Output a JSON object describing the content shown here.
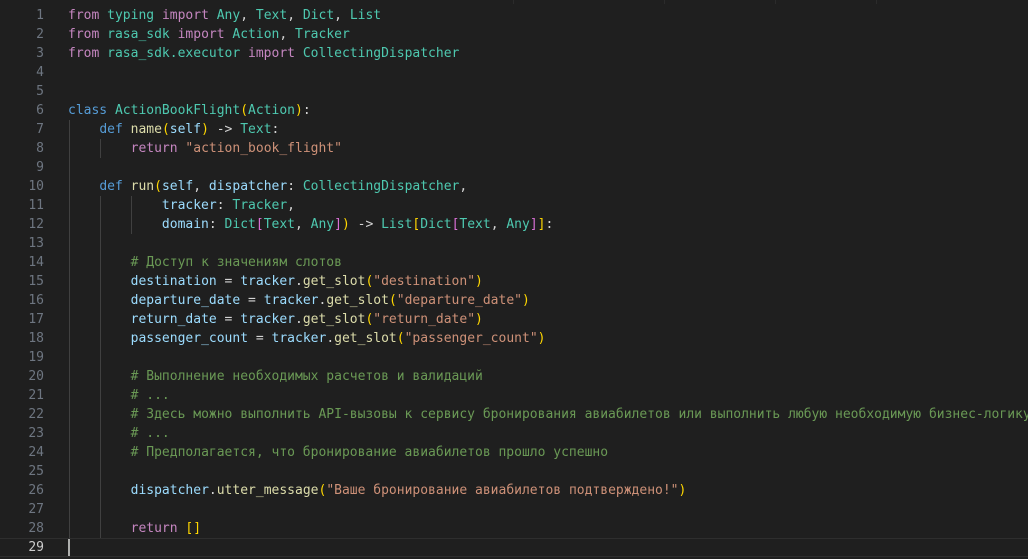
{
  "editor": {
    "active_line": 29,
    "lines": [
      {
        "n": "1",
        "tokens": [
          [
            "kw",
            "from"
          ],
          [
            "op",
            " "
          ],
          [
            "cls",
            "typing"
          ],
          [
            "op",
            " "
          ],
          [
            "kw",
            "import"
          ],
          [
            "op",
            " "
          ],
          [
            "cls",
            "Any"
          ],
          [
            "op",
            ", "
          ],
          [
            "cls",
            "Text"
          ],
          [
            "op",
            ", "
          ],
          [
            "cls",
            "Dict"
          ],
          [
            "op",
            ", "
          ],
          [
            "cls",
            "List"
          ]
        ]
      },
      {
        "n": "2",
        "tokens": [
          [
            "kw",
            "from"
          ],
          [
            "op",
            " "
          ],
          [
            "cls",
            "rasa_sdk"
          ],
          [
            "op",
            " "
          ],
          [
            "kw",
            "import"
          ],
          [
            "op",
            " "
          ],
          [
            "cls",
            "Action"
          ],
          [
            "op",
            ", "
          ],
          [
            "cls",
            "Tracker"
          ]
        ]
      },
      {
        "n": "3",
        "tokens": [
          [
            "kw",
            "from"
          ],
          [
            "op",
            " "
          ],
          [
            "cls",
            "rasa_sdk.executor"
          ],
          [
            "op",
            " "
          ],
          [
            "kw",
            "import"
          ],
          [
            "op",
            " "
          ],
          [
            "cls",
            "CollectingDispatcher"
          ]
        ]
      },
      {
        "n": "4",
        "tokens": []
      },
      {
        "n": "5",
        "tokens": []
      },
      {
        "n": "6",
        "tokens": [
          [
            "def",
            "class"
          ],
          [
            "op",
            " "
          ],
          [
            "cls",
            "ActionBookFlight"
          ],
          [
            "p1",
            "("
          ],
          [
            "cls",
            "Action"
          ],
          [
            "p1",
            ")"
          ],
          [
            "op",
            ":"
          ]
        ]
      },
      {
        "n": "7",
        "tokens": [
          [
            "op",
            "    "
          ],
          [
            "def",
            "def"
          ],
          [
            "op",
            " "
          ],
          [
            "fn",
            "name"
          ],
          [
            "p1",
            "("
          ],
          [
            "var",
            "self"
          ],
          [
            "p1",
            ")"
          ],
          [
            "op",
            " -> "
          ],
          [
            "cls",
            "Text"
          ],
          [
            "op",
            ":"
          ]
        ]
      },
      {
        "n": "8",
        "tokens": [
          [
            "op",
            "        "
          ],
          [
            "kw",
            "return"
          ],
          [
            "op",
            " "
          ],
          [
            "str",
            "\"action_book_flight\""
          ]
        ]
      },
      {
        "n": "9",
        "tokens": []
      },
      {
        "n": "10",
        "tokens": [
          [
            "op",
            "    "
          ],
          [
            "def",
            "def"
          ],
          [
            "op",
            " "
          ],
          [
            "fn",
            "run"
          ],
          [
            "p1",
            "("
          ],
          [
            "var",
            "self"
          ],
          [
            "op",
            ", "
          ],
          [
            "var",
            "dispatcher"
          ],
          [
            "op",
            ": "
          ],
          [
            "cls",
            "CollectingDispatcher"
          ],
          [
            "op",
            ","
          ]
        ]
      },
      {
        "n": "11",
        "tokens": [
          [
            "op",
            "            "
          ],
          [
            "var",
            "tracker"
          ],
          [
            "op",
            ": "
          ],
          [
            "cls",
            "Tracker"
          ],
          [
            "op",
            ","
          ]
        ]
      },
      {
        "n": "12",
        "tokens": [
          [
            "op",
            "            "
          ],
          [
            "var",
            "domain"
          ],
          [
            "op",
            ": "
          ],
          [
            "cls",
            "Dict"
          ],
          [
            "p2",
            "["
          ],
          [
            "cls",
            "Text"
          ],
          [
            "op",
            ", "
          ],
          [
            "cls",
            "Any"
          ],
          [
            "p2",
            "]"
          ],
          [
            "p1",
            ")"
          ],
          [
            "op",
            " -> "
          ],
          [
            "cls",
            "List"
          ],
          [
            "p1",
            "["
          ],
          [
            "cls",
            "Dict"
          ],
          [
            "p2",
            "["
          ],
          [
            "cls",
            "Text"
          ],
          [
            "op",
            ", "
          ],
          [
            "cls",
            "Any"
          ],
          [
            "p2",
            "]"
          ],
          [
            "p1",
            "]"
          ],
          [
            "op",
            ":"
          ]
        ]
      },
      {
        "n": "13",
        "tokens": []
      },
      {
        "n": "14",
        "tokens": [
          [
            "op",
            "        "
          ],
          [
            "com",
            "# Доступ к значениям слотов"
          ]
        ]
      },
      {
        "n": "15",
        "tokens": [
          [
            "op",
            "        "
          ],
          [
            "var",
            "destination"
          ],
          [
            "op",
            " = "
          ],
          [
            "var",
            "tracker"
          ],
          [
            "op",
            "."
          ],
          [
            "fn",
            "get_slot"
          ],
          [
            "p1",
            "("
          ],
          [
            "str",
            "\"destination\""
          ],
          [
            "p1",
            ")"
          ]
        ]
      },
      {
        "n": "16",
        "tokens": [
          [
            "op",
            "        "
          ],
          [
            "var",
            "departure_date"
          ],
          [
            "op",
            " = "
          ],
          [
            "var",
            "tracker"
          ],
          [
            "op",
            "."
          ],
          [
            "fn",
            "get_slot"
          ],
          [
            "p1",
            "("
          ],
          [
            "str",
            "\"departure_date\""
          ],
          [
            "p1",
            ")"
          ]
        ]
      },
      {
        "n": "17",
        "tokens": [
          [
            "op",
            "        "
          ],
          [
            "var",
            "return_date"
          ],
          [
            "op",
            " = "
          ],
          [
            "var",
            "tracker"
          ],
          [
            "op",
            "."
          ],
          [
            "fn",
            "get_slot"
          ],
          [
            "p1",
            "("
          ],
          [
            "str",
            "\"return_date\""
          ],
          [
            "p1",
            ")"
          ]
        ]
      },
      {
        "n": "18",
        "tokens": [
          [
            "op",
            "        "
          ],
          [
            "var",
            "passenger_count"
          ],
          [
            "op",
            " = "
          ],
          [
            "var",
            "tracker"
          ],
          [
            "op",
            "."
          ],
          [
            "fn",
            "get_slot"
          ],
          [
            "p1",
            "("
          ],
          [
            "str",
            "\"passenger_count\""
          ],
          [
            "p1",
            ")"
          ]
        ]
      },
      {
        "n": "19",
        "tokens": []
      },
      {
        "n": "20",
        "tokens": [
          [
            "op",
            "        "
          ],
          [
            "com",
            "# Выполнение необходимых расчетов и валидаций"
          ]
        ]
      },
      {
        "n": "21",
        "tokens": [
          [
            "op",
            "        "
          ],
          [
            "com",
            "# ..."
          ]
        ]
      },
      {
        "n": "22",
        "tokens": [
          [
            "op",
            "        "
          ],
          [
            "com",
            "# Здесь можно выполнить API-вызовы к сервису бронирования авиабилетов или выполнить любую необходимую бизнес-логику"
          ]
        ]
      },
      {
        "n": "23",
        "tokens": [
          [
            "op",
            "        "
          ],
          [
            "com",
            "# ..."
          ]
        ]
      },
      {
        "n": "24",
        "tokens": [
          [
            "op",
            "        "
          ],
          [
            "com",
            "# Предполагается, что бронирование авиабилетов прошло успешно"
          ]
        ]
      },
      {
        "n": "25",
        "tokens": []
      },
      {
        "n": "26",
        "tokens": [
          [
            "op",
            "        "
          ],
          [
            "var",
            "dispatcher"
          ],
          [
            "op",
            "."
          ],
          [
            "fn",
            "utter_message"
          ],
          [
            "p1",
            "("
          ],
          [
            "str",
            "\"Ваше бронирование авиабилетов подтверждено!\""
          ],
          [
            "p1",
            ")"
          ]
        ]
      },
      {
        "n": "27",
        "tokens": []
      },
      {
        "n": "28",
        "tokens": [
          [
            "op",
            "        "
          ],
          [
            "kw",
            "return"
          ],
          [
            "op",
            " "
          ],
          [
            "p1",
            "[]"
          ]
        ]
      },
      {
        "n": "29",
        "tokens": []
      }
    ]
  }
}
